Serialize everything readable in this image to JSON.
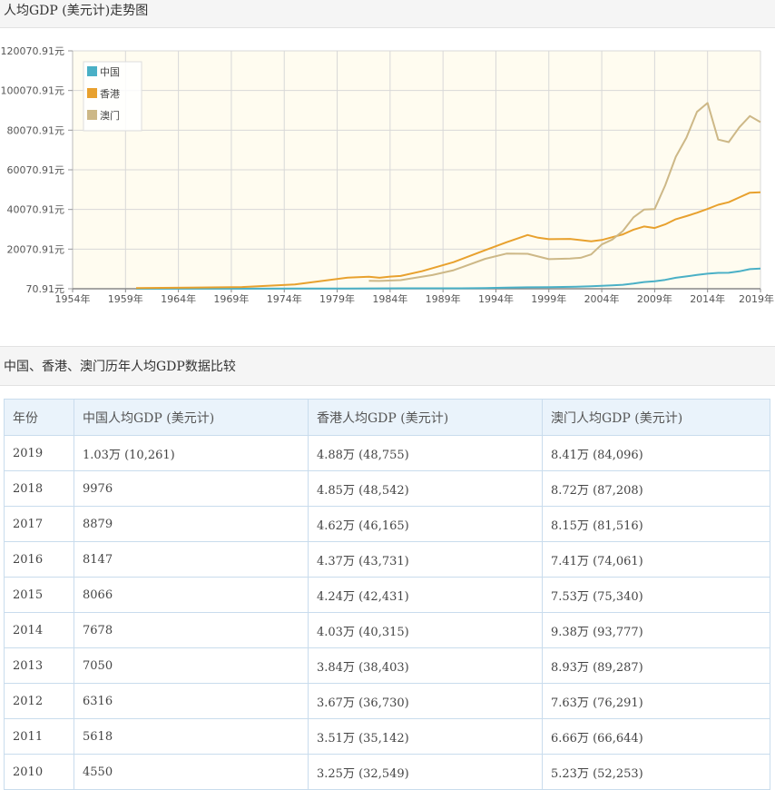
{
  "chart_section": {
    "title": "人均GDP (美元计)走势图"
  },
  "table_section": {
    "title": "中国、香港、澳门历年人均GDP数据比较"
  },
  "chart_data": {
    "type": "line",
    "title": "",
    "xlabel": "",
    "ylabel": "",
    "ylim": [
      70.91,
      120070.91
    ],
    "yticks": [
      "120070.91元",
      "100070.91元",
      "80070.91元",
      "60070.91元",
      "40070.91元",
      "20070.91元",
      "70.91元"
    ],
    "ytick_values": [
      120070.91,
      100070.91,
      80070.91,
      60070.91,
      40070.91,
      20070.91,
      70.91
    ],
    "xlim": [
      1954,
      2019
    ],
    "xticks": [
      "1954年",
      "1959年",
      "1964年",
      "1969年",
      "1974年",
      "1979年",
      "1984年",
      "1989年",
      "1994年",
      "1999年",
      "2004年",
      "2009年",
      "2014年",
      "2019年"
    ],
    "xtick_values": [
      1954,
      1959,
      1964,
      1969,
      1974,
      1979,
      1984,
      1989,
      1994,
      1999,
      2004,
      2009,
      2014,
      2019
    ],
    "grid": true,
    "legend_position": "top-left",
    "plot_background": "#fffcf0",
    "series": [
      {
        "name": "中国",
        "color": "#4ab0c6",
        "x": [
          1960,
          1965,
          1970,
          1975,
          1978,
          1980,
          1985,
          1990,
          1993,
          1995,
          1997,
          1999,
          2001,
          2003,
          2005,
          2006,
          2007,
          2008,
          2009,
          2010,
          2011,
          2012,
          2013,
          2014,
          2015,
          2016,
          2017,
          2018,
          2019
        ],
        "y": [
          90,
          98,
          113,
          178,
          156,
          195,
          294,
          318,
          377,
          610,
          782,
          873,
          1053,
          1288,
          1753,
          2099,
          2694,
          3468,
          3832,
          4550,
          5618,
          6316,
          7050,
          7678,
          8066,
          8147,
          8879,
          9976,
          10261
        ]
      },
      {
        "name": "香港",
        "color": "#e8a12e",
        "x": [
          1960,
          1965,
          1970,
          1975,
          1980,
          1982,
          1983,
          1984,
          1985,
          1987,
          1990,
          1993,
          1995,
          1997,
          1998,
          1999,
          2001,
          2003,
          2004,
          2005,
          2006,
          2007,
          2008,
          2009,
          2010,
          2011,
          2012,
          2013,
          2014,
          2015,
          2016,
          2017,
          2018,
          2019
        ],
        "y": [
          429,
          677,
          960,
          2252,
          5700,
          6130,
          5600,
          6210,
          6540,
          8910,
          13490,
          19600,
          23500,
          27170,
          25810,
          25090,
          25230,
          23980,
          24665,
          26094,
          27490,
          29900,
          31490,
          30690,
          32549,
          35142,
          36730,
          38403,
          40315,
          42431,
          43731,
          46165,
          48542,
          48755
        ]
      },
      {
        "name": "澳门",
        "color": "#cdb887",
        "x": [
          1982,
          1983,
          1985,
          1988,
          1990,
          1993,
          1995,
          1997,
          1999,
          2001,
          2002,
          2003,
          2004,
          2005,
          2006,
          2007,
          2008,
          2009,
          2010,
          2011,
          2012,
          2013,
          2014,
          2015,
          2016,
          2017,
          2018,
          2019
        ],
        "y": [
          4100,
          4000,
          4400,
          7000,
          9400,
          15200,
          17800,
          17700,
          15000,
          15300,
          15700,
          17400,
          22400,
          24900,
          29200,
          36100,
          40000,
          40300,
          52253,
          66644,
          76291,
          89287,
          93777,
          75340,
          74061,
          81516,
          87208,
          84096
        ]
      }
    ]
  },
  "table": {
    "headers": [
      "年份",
      "中国人均GDP (美元计)",
      "香港人均GDP (美元计)",
      "澳门人均GDP (美元计)"
    ],
    "rows": [
      [
        "2019",
        "1.03万 (10,261)",
        "4.88万 (48,755)",
        "8.41万 (84,096)"
      ],
      [
        "2018",
        "9976",
        "4.85万 (48,542)",
        "8.72万 (87,208)"
      ],
      [
        "2017",
        "8879",
        "4.62万 (46,165)",
        "8.15万 (81,516)"
      ],
      [
        "2016",
        "8147",
        "4.37万 (43,731)",
        "7.41万 (74,061)"
      ],
      [
        "2015",
        "8066",
        "4.24万 (42,431)",
        "7.53万 (75,340)"
      ],
      [
        "2014",
        "7678",
        "4.03万 (40,315)",
        "9.38万 (93,777)"
      ],
      [
        "2013",
        "7050",
        "3.84万 (38,403)",
        "8.93万 (89,287)"
      ],
      [
        "2012",
        "6316",
        "3.67万 (36,730)",
        "7.63万 (76,291)"
      ],
      [
        "2011",
        "5618",
        "3.51万 (35,142)",
        "6.66万 (66,644)"
      ],
      [
        "2010",
        "4550",
        "3.25万 (32,549)",
        "5.23万 (52,253)"
      ]
    ]
  }
}
